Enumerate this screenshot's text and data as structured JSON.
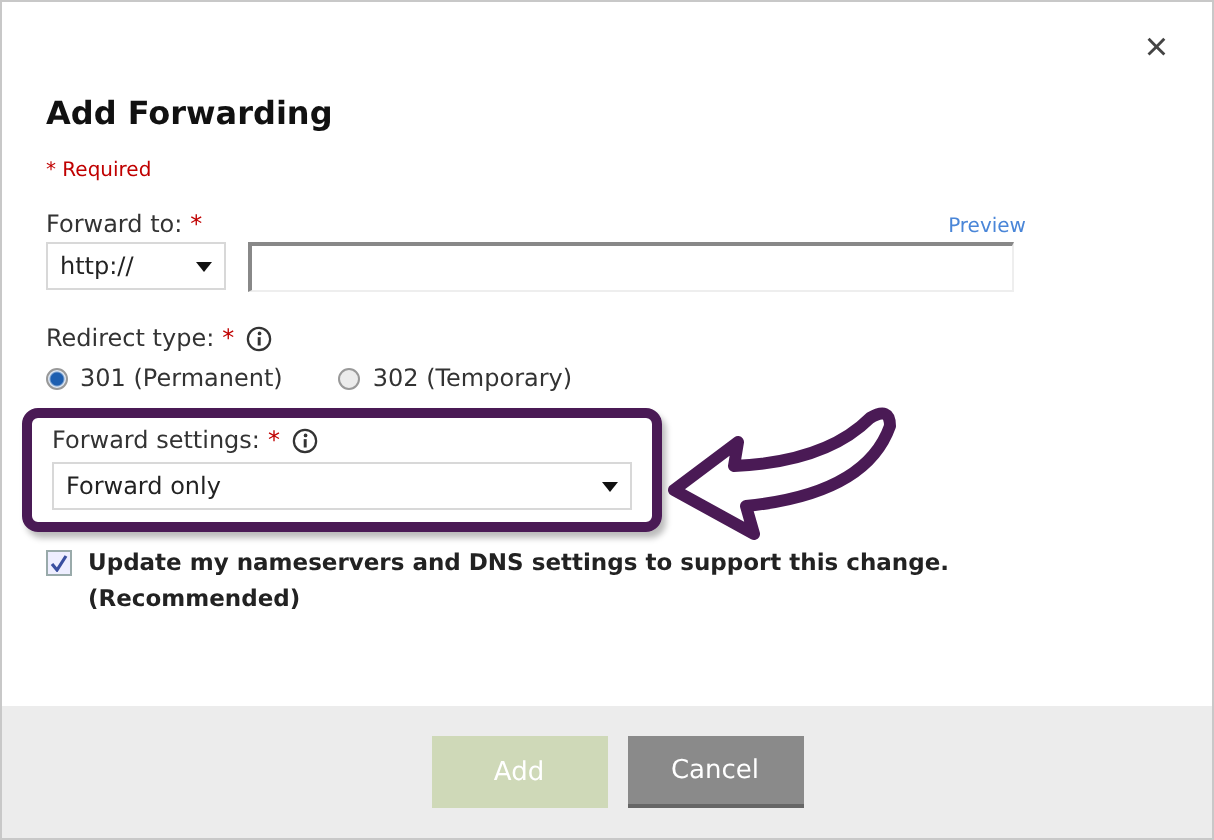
{
  "dialog": {
    "title": "Add Forwarding",
    "close": "×",
    "required_note": "* Required"
  },
  "forward_to": {
    "label": "Forward to:",
    "required_mark": "*",
    "preview_link": "Preview",
    "protocol": "http://"
  },
  "redirect_type": {
    "label": "Redirect type:",
    "required_mark": "*",
    "options": [
      {
        "label": "301 (Permanent)",
        "selected": true
      },
      {
        "label": "302 (Temporary)",
        "selected": false
      }
    ]
  },
  "forward_settings": {
    "label": "Forward settings:",
    "required_mark": "*",
    "value": "Forward only",
    "highlighted": true
  },
  "update_dns": {
    "label": "Update my nameservers and DNS settings to support this change. (Recommended)",
    "checked": true
  },
  "buttons": [
    {
      "label": "Add",
      "kind": "primary",
      "disabled": true
    },
    {
      "label": "Cancel",
      "kind": "secondary",
      "disabled": false
    }
  ]
}
